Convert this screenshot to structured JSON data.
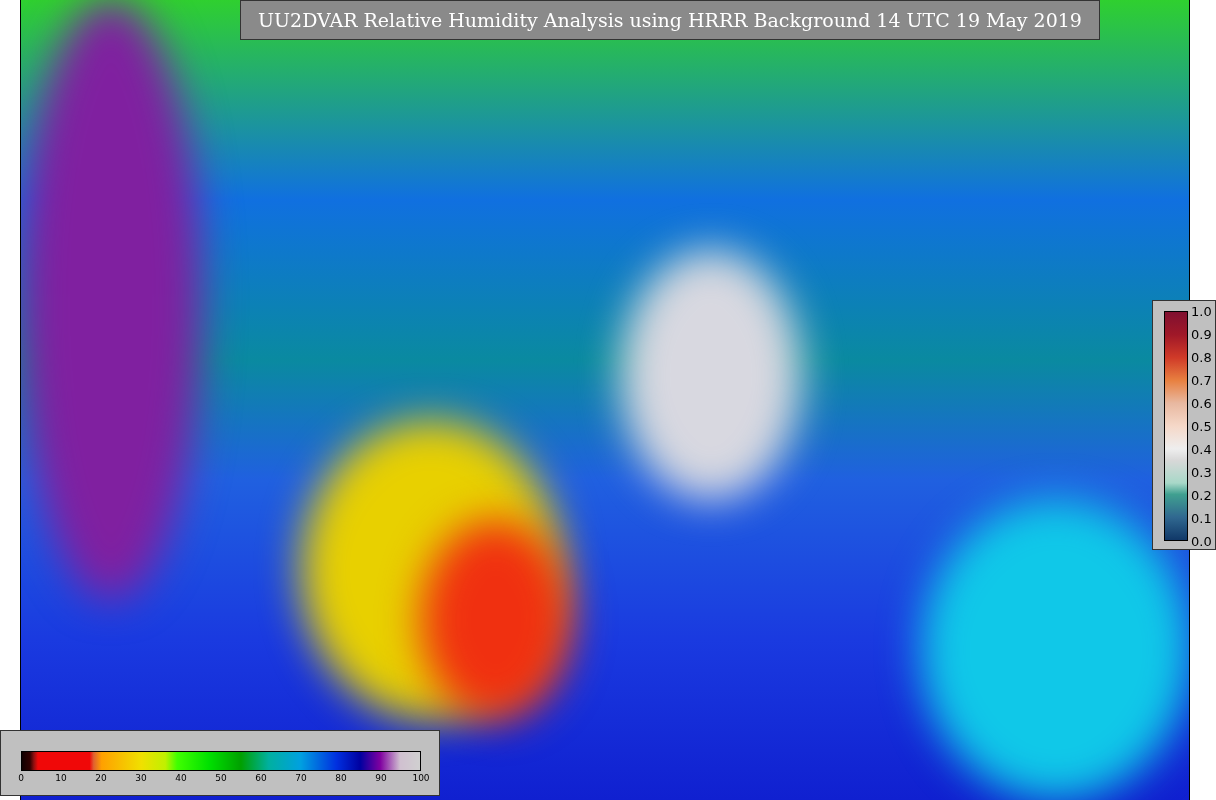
{
  "title": "UU2DVAR Relative Humidity Analysis using HRRR Background 14 UTC 19 May 2019",
  "humidity_colorbar": {
    "ticks": [
      "0",
      "10",
      "20",
      "30",
      "40",
      "50",
      "60",
      "70",
      "80",
      "90",
      "100"
    ]
  },
  "scale_colorbar": {
    "ticks": [
      "1.0",
      "0.9",
      "0.8",
      "0.7",
      "0.6",
      "0.5",
      "0.4",
      "0.3",
      "0.2",
      "0.1",
      "0.0"
    ]
  }
}
